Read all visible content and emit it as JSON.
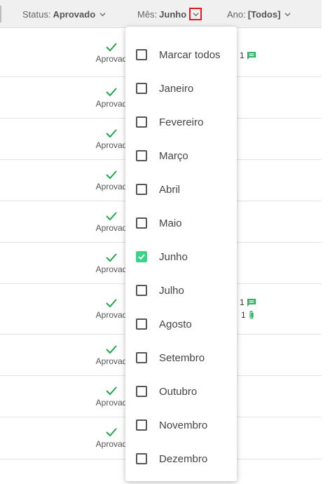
{
  "filters": {
    "status": {
      "label": "Status:",
      "value": "Aprovado"
    },
    "mes": {
      "label": "Mês:",
      "value": "Junho"
    },
    "ano": {
      "label": "Ano:",
      "value": "[Todos]"
    }
  },
  "rows": [
    {
      "status": "Aprovad",
      "comments": "1",
      "attachments": "",
      "height": 0
    },
    {
      "status": "Aprovad"
    },
    {
      "status": "Aprovad"
    },
    {
      "status": "Aprovad"
    },
    {
      "status": "Aprovad"
    },
    {
      "status": "Aprovad"
    },
    {
      "status": "Aprovad",
      "comments": "1",
      "attachments": "1"
    },
    {
      "status": "Aprovad"
    },
    {
      "status": "Aprovad"
    },
    {
      "status": "Aprovad"
    }
  ],
  "month_menu": {
    "options": [
      {
        "label": "Marcar todos",
        "checked": false
      },
      {
        "label": "Janeiro",
        "checked": false
      },
      {
        "label": "Fevereiro",
        "checked": false
      },
      {
        "label": "Março",
        "checked": false
      },
      {
        "label": "Abril",
        "checked": false
      },
      {
        "label": "Maio",
        "checked": false
      },
      {
        "label": "Junho",
        "checked": true
      },
      {
        "label": "Julho",
        "checked": false
      },
      {
        "label": "Agosto",
        "checked": false
      },
      {
        "label": "Setembro",
        "checked": false
      },
      {
        "label": "Outubro",
        "checked": false
      },
      {
        "label": "Novembro",
        "checked": false
      },
      {
        "label": "Dezembro",
        "checked": false
      }
    ]
  },
  "colors": {
    "check_green": "#22a64b",
    "checkbox_checked": "#3bd48a",
    "highlight_red": "#e8171f",
    "comment_green": "#2db266"
  }
}
